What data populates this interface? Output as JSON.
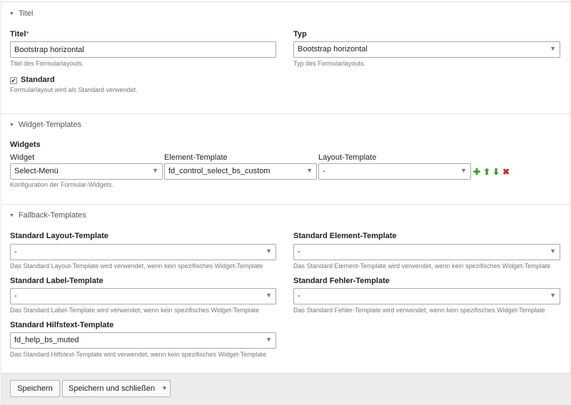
{
  "sections": {
    "title": "Titel",
    "widgets": "Widget-Templates",
    "fallback": "Fallback-Templates"
  },
  "title_section": {
    "titel_label": "Titel",
    "required_mark": "*",
    "titel_value": "Bootstrap horizontal",
    "titel_help": "Titel des Formularlayouts.",
    "typ_label": "Typ",
    "typ_value": "Bootstrap horizontal",
    "typ_help": "Typ des Formularlayouts.",
    "standard_label": "Standard",
    "standard_checked": true,
    "standard_help": "Formularlayout wird als Standard verwendet."
  },
  "widgets_section": {
    "heading": "Widgets",
    "col_widget": "Widget",
    "col_element": "Element-Template",
    "col_layout": "Layout-Template",
    "row": {
      "widget": "Select-Menü",
      "element": "fd_control_select_bs_custom",
      "layout": "-"
    },
    "help": "Konfiguration der Formular-Widgets."
  },
  "fallback_section": {
    "layout_label": "Standard Layout-Template",
    "layout_value": "-",
    "layout_help": "Das Standard Layout-Template wird verwendet, wenn kein spezifisches Widget-Template",
    "element_label": "Standard Element-Template",
    "element_value": "-",
    "element_help": "Das Standard Element-Template wird verwendet, wenn kein spezifisches Widget-Template",
    "labeltpl_label": "Standard Label-Template",
    "labeltpl_value": "-",
    "labeltpl_help": "Das Standard Label-Template wird verwendet, wenn kein spezifisches Widget-Template",
    "error_label": "Standard Fehler-Template",
    "error_value": "-",
    "error_help": "Das Standard Fehler-Template wird verwendet, wenn kein spezifisches Widget-Template",
    "helptext_label": "Standard Hilfstext-Template",
    "helptext_value": "fd_help_bs_muted",
    "helptext_help": "Das Standard Hilfstext-Template wird verwendet, wenn kein spezifisches Widget-Template"
  },
  "footer": {
    "save": "Speichern",
    "save_close": "Speichern und schließen"
  },
  "icons": {
    "collapse": "▼",
    "caret": "▼",
    "check": "✔",
    "add": "✚",
    "up": "⬆",
    "down": "⬇",
    "delete": "✖"
  },
  "colors": {
    "add_icon": "#3c9a2a",
    "delete_icon": "#c62a2a",
    "required": "#cc3333"
  }
}
